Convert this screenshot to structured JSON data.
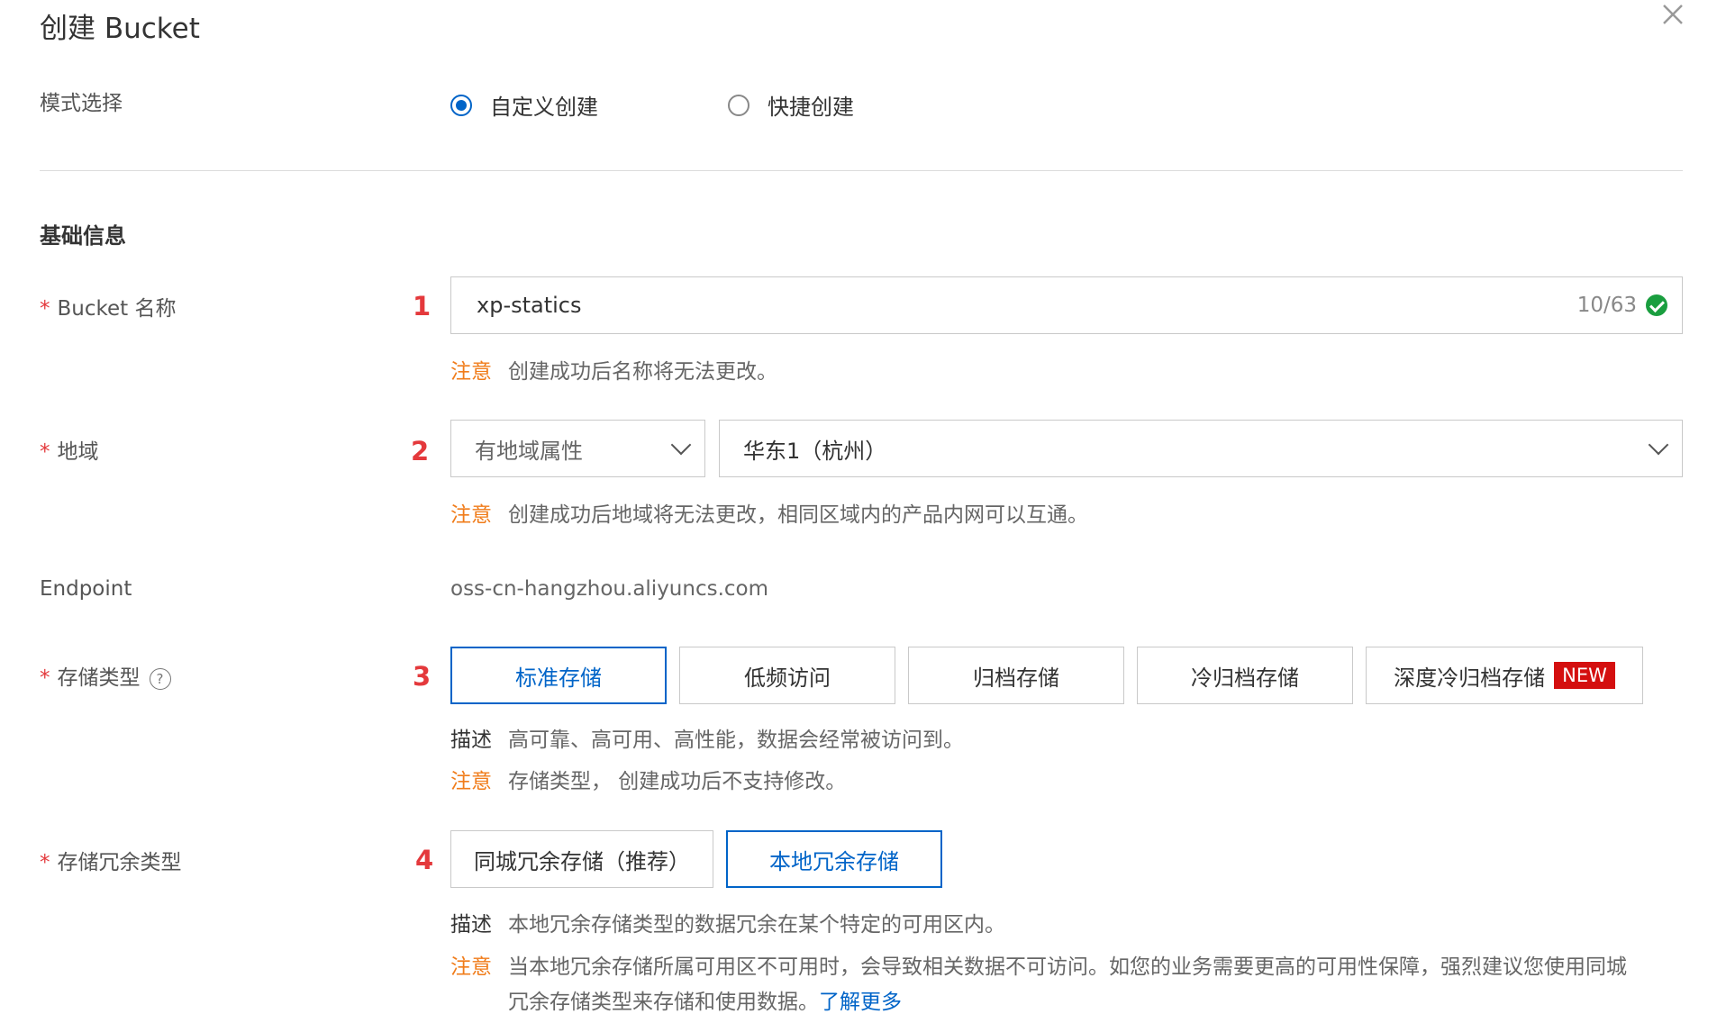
{
  "dialog": {
    "title": "创建 Bucket",
    "close_icon": "close-icon"
  },
  "mode": {
    "label": "模式选择",
    "options": [
      {
        "label": "自定义创建",
        "selected": true
      },
      {
        "label": "快捷创建",
        "selected": false
      }
    ]
  },
  "section_title": "基础信息",
  "bucket_name": {
    "required_mark": "*",
    "label": "Bucket 名称",
    "step": "1",
    "value": "xp-statics",
    "counter": "10/63",
    "status_icon": "check-circle-icon",
    "note_tag": "注意",
    "note": "创建成功后名称将无法更改。"
  },
  "region": {
    "required_mark": "*",
    "label": "地域",
    "step": "2",
    "attribute_select": "有地域属性",
    "region_select": "华东1（杭州）",
    "note_tag": "注意",
    "note": "创建成功后地域将无法更改，相同区域内的产品内网可以互通。"
  },
  "endpoint": {
    "label": "Endpoint",
    "value": "oss-cn-hangzhou.aliyuncs.com"
  },
  "storage_class": {
    "required_mark": "*",
    "label": "存储类型",
    "help_icon": "?",
    "step": "3",
    "options": [
      {
        "label": "标准存储",
        "selected": true
      },
      {
        "label": "低频访问",
        "selected": false
      },
      {
        "label": "归档存储",
        "selected": false
      },
      {
        "label": "冷归档存储",
        "selected": false
      },
      {
        "label": "深度冷归档存储",
        "selected": false,
        "badge": "NEW"
      }
    ],
    "desc_tag": "描述",
    "desc": "高可靠、高可用、高性能，数据会经常被访问到。",
    "note_tag": "注意",
    "note": "存储类型， 创建成功后不支持修改。"
  },
  "redundancy": {
    "required_mark": "*",
    "label": "存储冗余类型",
    "step": "4",
    "options": [
      {
        "label": "同城冗余存储（推荐）",
        "selected": false
      },
      {
        "label": "本地冗余存储",
        "selected": true
      }
    ],
    "desc_tag": "描述",
    "desc": "本地冗余存储类型的数据冗余在某个特定的可用区内。",
    "note_tag": "注意",
    "note_line1": "当本地冗余存储所属可用区不可用时，会导致相关数据不可访问。如您的业务需要更高的可用性保障，强烈建议您使用同城",
    "note_line2": "冗余存储类型来存储和使用数据。",
    "learn_more": "了解更多"
  },
  "colors": {
    "accent": "#0064c8",
    "required": "#e4393c",
    "warning": "#f07c1a",
    "success": "#1a9e3f",
    "badge": "#d40f0f"
  }
}
